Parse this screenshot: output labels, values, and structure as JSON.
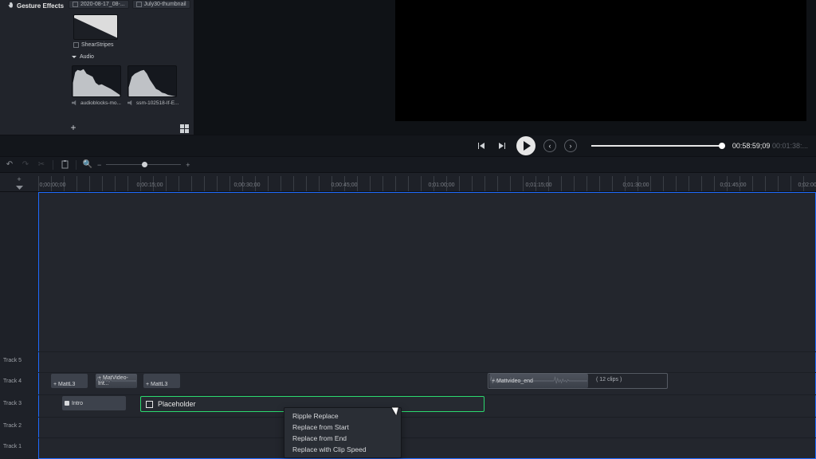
{
  "media_panel": {
    "tab": "Gesture Effects",
    "file_tabs": [
      "2020-08-17_08-...",
      "July30-thumbnail"
    ],
    "shear_label": "ShearStripes",
    "audio_section": "Audio",
    "audio_items": [
      "audioblocks-mo...",
      "ssm-102518-If-E..."
    ]
  },
  "playback": {
    "timecode": "00:58:59;09",
    "duration": "00:01:38:..."
  },
  "ruler": {
    "labels": [
      "0;00;00;00",
      "0;00:15;00",
      "0;00:30;00",
      "0;00:45;00",
      "0;01:00;00",
      "0;01:15;00",
      "0;01:30;00",
      "0;01:45;00",
      "0;02:00;00"
    ]
  },
  "zoom": {
    "knob_pct": 50
  },
  "tracks": {
    "t1": "Track 1",
    "t2": "Track 2",
    "t3": "Track 3",
    "t4": "Track 4",
    "t5": "Track 5"
  },
  "clips": {
    "intro": "Intro",
    "mattL3a": "+ MattL3",
    "matvideo": "+ MatVideo-Int...",
    "mattL3b": "+ MattL3",
    "mattend": "+ Mattvideo_end",
    "group_count": "( 12 clips )",
    "placeholder": "Placeholder"
  },
  "context_menu": {
    "items": [
      "Ripple Replace",
      "Replace from Start",
      "Replace from End",
      "Replace with Clip Speed"
    ]
  }
}
